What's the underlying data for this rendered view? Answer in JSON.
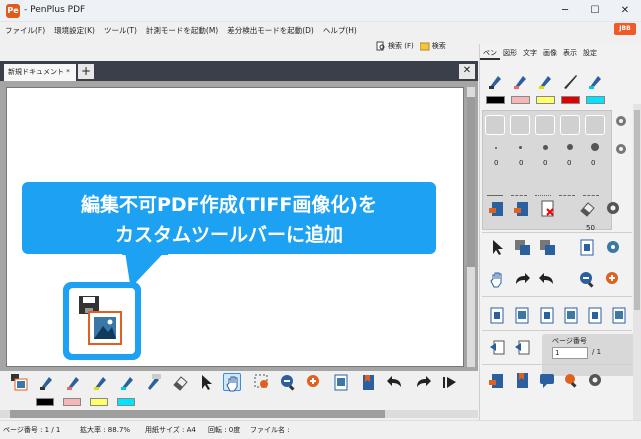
{
  "app": {
    "title": "- PenPlus PDF",
    "logo_text": "Pe",
    "minimize": "─",
    "maximize": "☐",
    "close": "✕",
    "ad_badge": "JBB"
  },
  "menu": [
    "ファイル(F)",
    "環境設定(K)",
    "ツール(T)",
    "計測モードを起動(M)",
    "差分検出モードを起動(D)",
    "ヘルプ(H)"
  ],
  "search": {
    "label_f": "検索 (F)",
    "label_2": "検索"
  },
  "doc": {
    "tab_label": "新規ドキュメント *",
    "tab_close": "×",
    "add_tab": "+",
    "close_doc": "✕"
  },
  "callout": {
    "line1": "編集不可PDF作成(TIFF画像化)を",
    "line2": "カスタムツールバーに追加"
  },
  "status": {
    "page": "ページ番号 : 1 / 1",
    "zoom": "拡大率 : 88.7%",
    "paper": "用紙サイズ : A4",
    "rotate": "回転 : 0度",
    "file": "ファイル名 :"
  },
  "panel": {
    "tabs": [
      "ペン",
      "図形",
      "文字",
      "画像",
      "表示",
      "設定"
    ],
    "active_tab": "ペン",
    "dot_counts": [
      "0",
      "0",
      "0",
      "0",
      "0"
    ],
    "size_value": "50",
    "page_label": "ページ番号",
    "page_value": "1",
    "page_total": "/ 1"
  },
  "colors": {
    "accent": "#1da1f2",
    "swatches": [
      "#000000",
      "#f4b6b6",
      "#ffff66",
      "#e00000",
      "#00e5ff"
    ],
    "bottom_swatches": [
      "#000000",
      "#f4b6b6",
      "#ffff66",
      "#00e5ff"
    ]
  },
  "toolbar_icons": [
    "tiff-save-icon",
    "pen-icon",
    "highlighter-pink-icon",
    "highlighter-yellow-icon",
    "highlighter-cyan-icon",
    "abc-marker-icon",
    "eraser-icon",
    "pointer-icon",
    "hand-icon",
    "zoom-area-icon",
    "zoom-out-icon",
    "zoom-in-icon",
    "fit-page-icon",
    "bookmark-icon",
    "undo-icon",
    "redo-icon",
    "first-page-icon",
    "prev-page-icon"
  ]
}
